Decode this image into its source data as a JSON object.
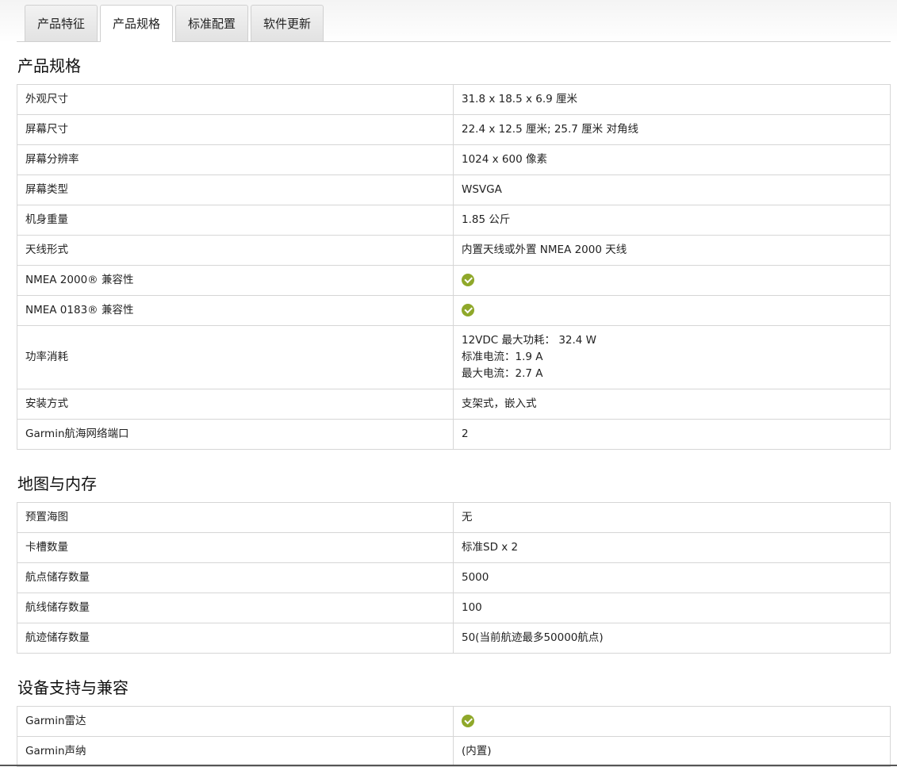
{
  "tabs": [
    {
      "label": "产品特征",
      "active": false
    },
    {
      "label": "产品规格",
      "active": true
    },
    {
      "label": "标准配置",
      "active": false
    },
    {
      "label": "软件更新",
      "active": false
    }
  ],
  "sections": [
    {
      "title": "产品规格",
      "rows": [
        {
          "label": "外观尺寸",
          "value": "31.8 x 18.5 x 6.9 厘米"
        },
        {
          "label": "屏幕尺寸",
          "value": "22.4 x 12.5 厘米; 25.7 厘米 对角线"
        },
        {
          "label": "屏幕分辨率",
          "value": "1024 x 600 像素"
        },
        {
          "label": "屏幕类型",
          "value": "WSVGA"
        },
        {
          "label": "机身重量",
          "value": "1.85 公斤"
        },
        {
          "label": "天线形式",
          "value": "内置天线或外置 NMEA 2000 天线"
        },
        {
          "label": "NMEA 2000® 兼容性",
          "icon": "check-circle-icon"
        },
        {
          "label": "NMEA 0183® 兼容性",
          "icon": "check-circle-icon"
        },
        {
          "label": "功率消耗",
          "lines": [
            "12VDC 最大功耗： 32.4 W",
            "标准电流：1.9 A",
            "最大电流：2.7 A"
          ]
        },
        {
          "label": "安装方式",
          "value": "支架式，嵌入式"
        },
        {
          "label": "Garmin航海网络端口",
          "value": "2"
        }
      ]
    },
    {
      "title": "地图与内存",
      "rows": [
        {
          "label": "预置海图",
          "value": "无"
        },
        {
          "label": "卡槽数量",
          "value": "标准SD x 2"
        },
        {
          "label": "航点储存数量",
          "value": "5000"
        },
        {
          "label": "航线储存数量",
          "value": "100"
        },
        {
          "label": "航迹储存数量",
          "value": "50(当前航迹最多50000航点)"
        }
      ]
    },
    {
      "title": "设备支持与兼容",
      "rows": [
        {
          "label": "Garmin雷达",
          "icon": "check-circle-icon"
        },
        {
          "label": "Garmin声纳",
          "value": "(内置)"
        }
      ]
    }
  ],
  "colors": {
    "check": "#8fa82a",
    "border": "#d6d6d6"
  }
}
